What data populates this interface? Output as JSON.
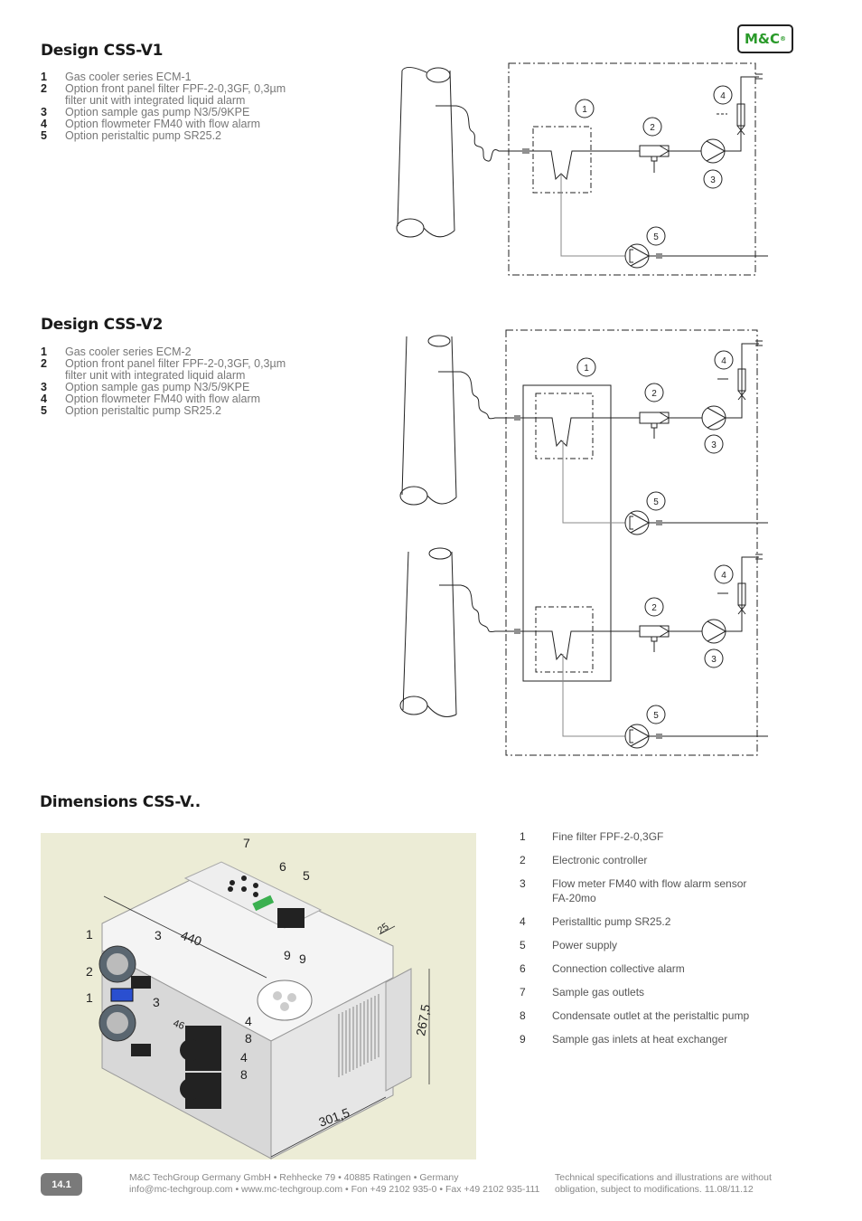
{
  "logo": {
    "text": "M&C",
    "mark": "®"
  },
  "design_v1": {
    "title": "Design CSS-V1",
    "items": [
      {
        "num": "1",
        "text": "Gas cooler series ECM-1"
      },
      {
        "num": "2",
        "text": "Option front panel filter FPF-2-0,3GF, 0,3µm filter unit with integrated liquid alarm"
      },
      {
        "num": "3",
        "text": "Option sample gas pump N3/5/9KPE"
      },
      {
        "num": "4",
        "text": "Option flowmeter FM40 with flow alarm"
      },
      {
        "num": "5",
        "text": "Option peristaltic pump SR25.2"
      }
    ],
    "diagram_labels": [
      "1",
      "2",
      "3",
      "4",
      "5"
    ]
  },
  "design_v2": {
    "title": "Design CSS-V2",
    "items": [
      {
        "num": "1",
        "text": "Gas cooler series ECM-2"
      },
      {
        "num": "2",
        "text": "Option front panel filter FPF-2-0,3GF, 0,3µm filter unit with integrated liquid alarm"
      },
      {
        "num": "3",
        "text": "Option sample gas pump N3/5/9KPE"
      },
      {
        "num": "4",
        "text": "Option flowmeter FM40 with flow alarm"
      },
      {
        "num": "5",
        "text": "Option peristaltic pump SR25.2"
      }
    ],
    "diagram_labels": [
      "1",
      "2",
      "3",
      "4",
      "5"
    ]
  },
  "dimensions": {
    "title": "Dimensions CSS-V..",
    "photo_labels": {
      "callouts": [
        "1",
        "2",
        "1",
        "3",
        "3",
        "4",
        "8",
        "4",
        "8",
        "5",
        "6",
        "7",
        "9",
        "9"
      ],
      "dim_440": "440",
      "dim_25": "25",
      "dim_2675": "267,5",
      "dim_3015": "301,5",
      "dim_46": "46"
    },
    "items": [
      {
        "num": "1",
        "text": "Fine filter FPF-2-0,3GF"
      },
      {
        "num": "2",
        "text": "Electronic controller"
      },
      {
        "num": "3",
        "text": "Flow meter FM40 with flow alarm sensor FA-20mo"
      },
      {
        "num": "4",
        "text": "Peristalltic pump SR25.2"
      },
      {
        "num": "5",
        "text": "Power supply"
      },
      {
        "num": "6",
        "text": "Connection collective alarm"
      },
      {
        "num": "7",
        "text": "Sample gas outlets"
      },
      {
        "num": "8",
        "text": "Condensate outlet at the peristaltic pump"
      },
      {
        "num": "9",
        "text": "Sample gas inlets at heat exchanger"
      }
    ]
  },
  "footer": {
    "page": "14.1",
    "company_line": "M&C TechGroup Germany GmbH • Rehhecke 79 • 40885 Ratingen • Germany",
    "contact_line": "info@mc-techgroup.com • www.mc-techgroup.com • Fon +49 2102 935-0 • Fax +49 2102 935-111",
    "disclaimer_line1": "Technical specifications and illustrations are without",
    "disclaimer_line2": "obligation, subject to modifications. 11.08/11.12"
  }
}
